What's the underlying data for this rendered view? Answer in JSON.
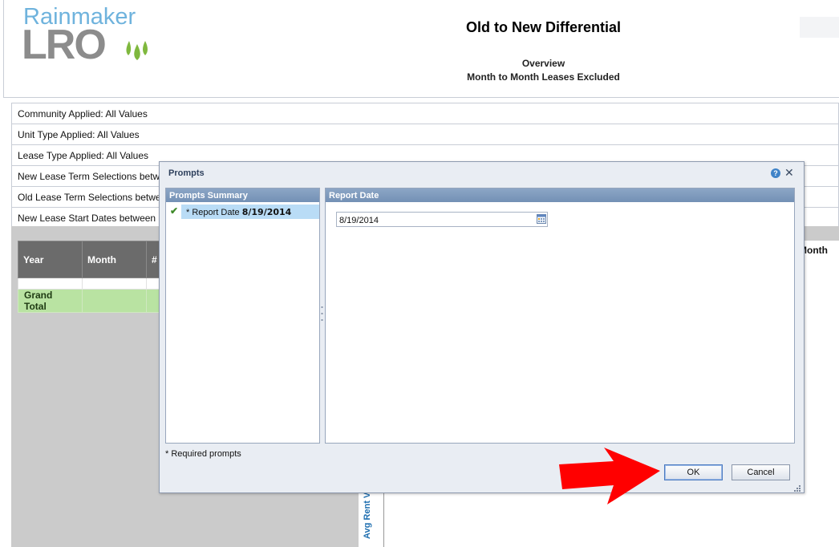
{
  "logo": {
    "line1": "Rainmaker",
    "line2": "LRO",
    "registered": "®"
  },
  "report": {
    "title": "Old to New Differential",
    "subtitle1": "Overview",
    "subtitle2": "Month to Month Leases Excluded"
  },
  "filters": [
    "Community Applied: All Values",
    "Unit Type Applied: All Values",
    "Lease Type Applied: All Values",
    "New Lease Term Selections betw",
    "Old Lease Term Selections betwe",
    "New Lease Start Dates between"
  ],
  "table": {
    "headers": [
      "Year",
      "Month",
      "#"
    ],
    "grand_total_label": "Grand Total"
  },
  "background_labels": {
    "month": "Month",
    "avg_rent": "Avg Rent V"
  },
  "dialog": {
    "title": "Prompts",
    "help_icon": "?",
    "close_icon": "✕",
    "summary_header": "Prompts Summary",
    "summary_item_prefix": "* Report Date",
    "summary_item_value": "8/19/2014",
    "right_header": "Report Date",
    "date_value": "8/19/2014",
    "required_note": "* Required prompts",
    "ok_label": "OK",
    "cancel_label": "Cancel"
  },
  "colors": {
    "logo_blue": "#6fb3dd",
    "logo_gray": "#8c8c8c",
    "grand_total_bg": "#b9e3a2",
    "header_dark": "#6b6b6b",
    "panel_header": "#7f9abd",
    "selection": "#b9dcf6",
    "arrow": "#ff0000"
  },
  "icons": {
    "check": "check-icon",
    "calendar": "calendar-icon",
    "help": "help-icon",
    "close": "close-icon",
    "arrow": "red-arrow"
  }
}
